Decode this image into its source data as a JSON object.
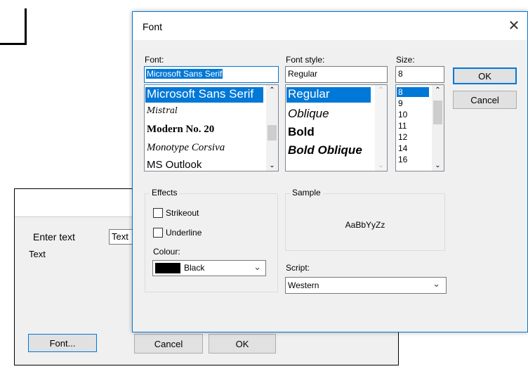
{
  "background_dialog": {
    "enter_text_label": "Enter text",
    "text_field_value": "Text",
    "display_text": "Text",
    "font_button": "Font...",
    "cancel_button": "Cancel",
    "ok_button": "OK"
  },
  "font_dialog": {
    "title": "Font",
    "font_label": "Font:",
    "font_value": "Microsoft Sans Serif",
    "font_list": [
      "Microsoft Sans Serif",
      "Mistral",
      "Modern No. 20",
      "Monotype Corsiva",
      "MS Outlook"
    ],
    "style_label": "Font style:",
    "style_value": "Regular",
    "style_list": [
      "Regular",
      "Oblique",
      "Bold",
      "Bold Oblique"
    ],
    "size_label": "Size:",
    "size_value": "8",
    "size_list": [
      "8",
      "9",
      "10",
      "11",
      "12",
      "14",
      "16"
    ],
    "ok_button": "OK",
    "cancel_button": "Cancel",
    "effects_label": "Effects",
    "strikeout_label": "Strikeout",
    "underline_label": "Underline",
    "colour_label": "Colour:",
    "colour_value": "Black",
    "sample_label": "Sample",
    "sample_text": "AaBbYyZz",
    "script_label": "Script:",
    "script_value": "Western"
  }
}
